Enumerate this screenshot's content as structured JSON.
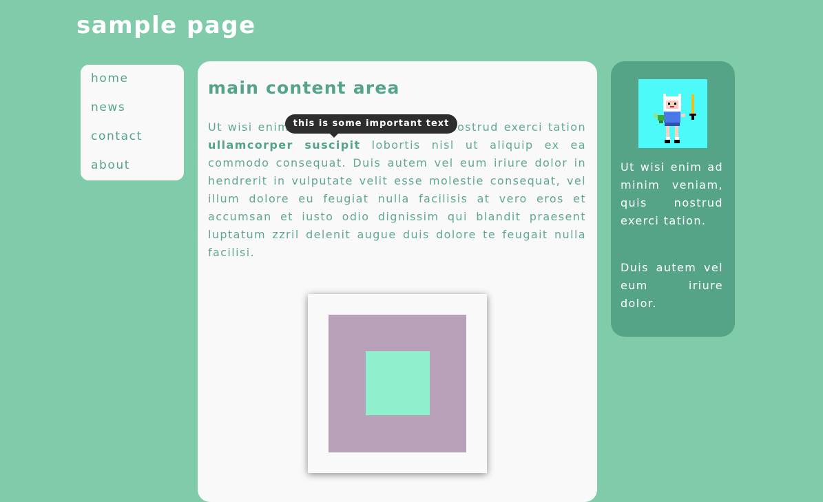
{
  "header": {
    "title": "sample page"
  },
  "nav": {
    "items": [
      {
        "label": "home"
      },
      {
        "label": "news"
      },
      {
        "label": "contact"
      },
      {
        "label": "about"
      }
    ]
  },
  "main": {
    "title": "main content area",
    "text_before": "Ut wisi enim ad minim veniam, quis nostrud exerci tation ",
    "link_text": "ullamcorper suscipit",
    "text_after": " lobortis nisl ut aliquip ex ea commodo consequat. Duis autem vel eum iriure dolor in hendrerit in vulputate velit esse molestie consequat, vel illum dolore eu feugiat nulla facilisis at vero eros et accumsan et iusto odio dignissim qui blandit praesent luptatum zzril delenit augue duis dolore te feugait nulla facilisi.",
    "tooltip": "this is some important text"
  },
  "aside": {
    "paragraph1": "Ut wisi enim ad minim veniam, quis nostrud exerci tation.",
    "paragraph2": "Duis autem vel eum iriure dolor."
  },
  "colors": {
    "background": "#80ccaa",
    "card": "#f9f9f9",
    "accent": "#55a488",
    "tooltip": "#2d2d2d",
    "avatar_bg": "#4dfafa",
    "square_outer": "#b9a0b9",
    "square_inner": "#8ef0cc"
  }
}
